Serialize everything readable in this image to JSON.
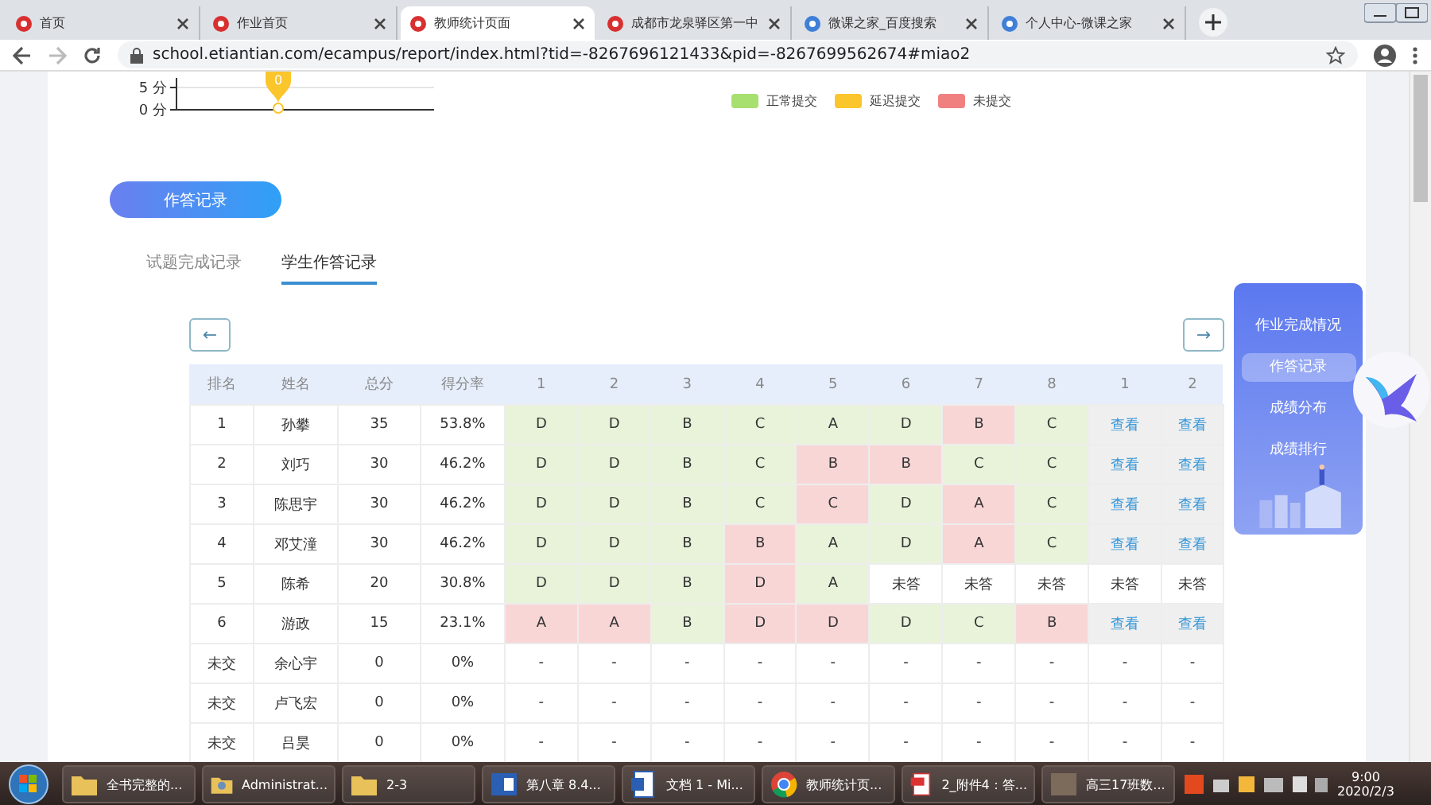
{
  "browser": {
    "tabs": [
      {
        "title": "首页",
        "selected": false
      },
      {
        "title": "作业首页",
        "selected": false
      },
      {
        "title": "教师统计页面",
        "selected": true
      },
      {
        "title": "成都市龙泉驿区第一中",
        "selected": false
      },
      {
        "title": "微课之家_百度搜索",
        "selected": false
      },
      {
        "title": "个人中心-微课之家",
        "selected": false
      }
    ],
    "url": "school.etiantian.com/ecampus/report/index.html?tid=-8267696121433&pid=-8267699562674#miao2"
  },
  "score_chart": {
    "y_ticks": [
      "5 分",
      "0 分"
    ],
    "marker_label": "0"
  },
  "legend": [
    {
      "label": "正常提交",
      "color": "#a8e070"
    },
    {
      "label": "延迟提交",
      "color": "#fbc52c"
    },
    {
      "label": "未提交",
      "color": "#f08080"
    }
  ],
  "section_button": "作答记录",
  "tabs": [
    {
      "label": "试题完成记录",
      "selected": false
    },
    {
      "label": "学生作答记录",
      "selected": true
    }
  ],
  "nav": {
    "prev": "←",
    "next": "→"
  },
  "table": {
    "columns": [
      "排名",
      "姓名",
      "总分",
      "得分率",
      "1",
      "2",
      "3",
      "4",
      "5",
      "6",
      "7",
      "8",
      "1",
      "2"
    ],
    "rows": [
      {
        "cells": [
          {
            "kind": "plain",
            "text": "1"
          },
          {
            "kind": "plain",
            "text": "孙攀"
          },
          {
            "kind": "plain",
            "text": "35"
          },
          {
            "kind": "plain",
            "text": "53.8%"
          },
          {
            "kind": "answer",
            "text": "D",
            "correct": true
          },
          {
            "kind": "answer",
            "text": "D",
            "correct": true
          },
          {
            "kind": "answer",
            "text": "B",
            "correct": true
          },
          {
            "kind": "answer",
            "text": "C",
            "correct": true
          },
          {
            "kind": "answer",
            "text": "A",
            "correct": true
          },
          {
            "kind": "answer",
            "text": "D",
            "correct": true
          },
          {
            "kind": "answer",
            "text": "B",
            "correct": false
          },
          {
            "kind": "answer",
            "text": "C",
            "correct": true
          },
          {
            "kind": "link",
            "text": "查看"
          },
          {
            "kind": "link",
            "text": "查看"
          }
        ]
      },
      {
        "cells": [
          {
            "kind": "plain",
            "text": "2"
          },
          {
            "kind": "plain",
            "text": "刘巧"
          },
          {
            "kind": "plain",
            "text": "30"
          },
          {
            "kind": "plain",
            "text": "46.2%"
          },
          {
            "kind": "answer",
            "text": "D",
            "correct": true
          },
          {
            "kind": "answer",
            "text": "D",
            "correct": true
          },
          {
            "kind": "answer",
            "text": "B",
            "correct": true
          },
          {
            "kind": "answer",
            "text": "C",
            "correct": true
          },
          {
            "kind": "answer",
            "text": "B",
            "correct": false
          },
          {
            "kind": "answer",
            "text": "B",
            "correct": false
          },
          {
            "kind": "answer",
            "text": "C",
            "correct": true
          },
          {
            "kind": "answer",
            "text": "C",
            "correct": true
          },
          {
            "kind": "link",
            "text": "查看"
          },
          {
            "kind": "link",
            "text": "查看"
          }
        ]
      },
      {
        "cells": [
          {
            "kind": "plain",
            "text": "3"
          },
          {
            "kind": "plain",
            "text": "陈思宇"
          },
          {
            "kind": "plain",
            "text": "30"
          },
          {
            "kind": "plain",
            "text": "46.2%"
          },
          {
            "kind": "answer",
            "text": "D",
            "correct": true
          },
          {
            "kind": "answer",
            "text": "D",
            "correct": true
          },
          {
            "kind": "answer",
            "text": "B",
            "correct": true
          },
          {
            "kind": "answer",
            "text": "C",
            "correct": true
          },
          {
            "kind": "answer",
            "text": "C",
            "correct": false
          },
          {
            "kind": "answer",
            "text": "D",
            "correct": true
          },
          {
            "kind": "answer",
            "text": "A",
            "correct": false
          },
          {
            "kind": "answer",
            "text": "C",
            "correct": true
          },
          {
            "kind": "link",
            "text": "查看"
          },
          {
            "kind": "link",
            "text": "查看"
          }
        ]
      },
      {
        "cells": [
          {
            "kind": "plain",
            "text": "4"
          },
          {
            "kind": "plain",
            "text": "邓艾潼"
          },
          {
            "kind": "plain",
            "text": "30"
          },
          {
            "kind": "plain",
            "text": "46.2%"
          },
          {
            "kind": "answer",
            "text": "D",
            "correct": true
          },
          {
            "kind": "answer",
            "text": "D",
            "correct": true
          },
          {
            "kind": "answer",
            "text": "B",
            "correct": true
          },
          {
            "kind": "answer",
            "text": "B",
            "correct": false
          },
          {
            "kind": "answer",
            "text": "A",
            "correct": true
          },
          {
            "kind": "answer",
            "text": "D",
            "correct": true
          },
          {
            "kind": "answer",
            "text": "A",
            "correct": false
          },
          {
            "kind": "answer",
            "text": "C",
            "correct": true
          },
          {
            "kind": "link",
            "text": "查看"
          },
          {
            "kind": "link",
            "text": "查看"
          }
        ]
      },
      {
        "cells": [
          {
            "kind": "plain",
            "text": "5"
          },
          {
            "kind": "plain",
            "text": "陈希"
          },
          {
            "kind": "plain",
            "text": "20"
          },
          {
            "kind": "plain",
            "text": "30.8%"
          },
          {
            "kind": "answer",
            "text": "D",
            "correct": true
          },
          {
            "kind": "answer",
            "text": "D",
            "correct": true
          },
          {
            "kind": "answer",
            "text": "B",
            "correct": true
          },
          {
            "kind": "answer",
            "text": "D",
            "correct": false
          },
          {
            "kind": "answer",
            "text": "A",
            "correct": true
          },
          {
            "kind": "plain",
            "text": "未答"
          },
          {
            "kind": "plain",
            "text": "未答"
          },
          {
            "kind": "plain",
            "text": "未答"
          },
          {
            "kind": "plain",
            "text": "未答"
          },
          {
            "kind": "plain",
            "text": "未答"
          }
        ]
      },
      {
        "cells": [
          {
            "kind": "plain",
            "text": "6"
          },
          {
            "kind": "plain",
            "text": "游政"
          },
          {
            "kind": "plain",
            "text": "15"
          },
          {
            "kind": "plain",
            "text": "23.1%"
          },
          {
            "kind": "answer",
            "text": "A",
            "correct": false
          },
          {
            "kind": "answer",
            "text": "A",
            "correct": false
          },
          {
            "kind": "answer",
            "text": "B",
            "correct": true
          },
          {
            "kind": "answer",
            "text": "D",
            "correct": false
          },
          {
            "kind": "answer",
            "text": "D",
            "correct": false
          },
          {
            "kind": "answer",
            "text": "D",
            "correct": true
          },
          {
            "kind": "answer",
            "text": "C",
            "correct": true
          },
          {
            "kind": "answer",
            "text": "B",
            "correct": false
          },
          {
            "kind": "link",
            "text": "查看"
          },
          {
            "kind": "link",
            "text": "查看"
          }
        ]
      },
      {
        "cells": [
          {
            "kind": "plain",
            "text": "未交"
          },
          {
            "kind": "plain",
            "text": "余心宇"
          },
          {
            "kind": "plain",
            "text": "0"
          },
          {
            "kind": "plain",
            "text": "0%"
          },
          {
            "kind": "plain",
            "text": "-"
          },
          {
            "kind": "plain",
            "text": "-"
          },
          {
            "kind": "plain",
            "text": "-"
          },
          {
            "kind": "plain",
            "text": "-"
          },
          {
            "kind": "plain",
            "text": "-"
          },
          {
            "kind": "plain",
            "text": "-"
          },
          {
            "kind": "plain",
            "text": "-"
          },
          {
            "kind": "plain",
            "text": "-"
          },
          {
            "kind": "plain",
            "text": "-"
          },
          {
            "kind": "plain",
            "text": "-"
          }
        ]
      },
      {
        "cells": [
          {
            "kind": "plain",
            "text": "未交"
          },
          {
            "kind": "plain",
            "text": "卢飞宏"
          },
          {
            "kind": "plain",
            "text": "0"
          },
          {
            "kind": "plain",
            "text": "0%"
          },
          {
            "kind": "plain",
            "text": "-"
          },
          {
            "kind": "plain",
            "text": "-"
          },
          {
            "kind": "plain",
            "text": "-"
          },
          {
            "kind": "plain",
            "text": "-"
          },
          {
            "kind": "plain",
            "text": "-"
          },
          {
            "kind": "plain",
            "text": "-"
          },
          {
            "kind": "plain",
            "text": "-"
          },
          {
            "kind": "plain",
            "text": "-"
          },
          {
            "kind": "plain",
            "text": "-"
          },
          {
            "kind": "plain",
            "text": "-"
          }
        ]
      },
      {
        "cells": [
          {
            "kind": "plain",
            "text": "未交"
          },
          {
            "kind": "plain",
            "text": "吕昊"
          },
          {
            "kind": "plain",
            "text": "0"
          },
          {
            "kind": "plain",
            "text": "0%"
          },
          {
            "kind": "plain",
            "text": "-"
          },
          {
            "kind": "plain",
            "text": "-"
          },
          {
            "kind": "plain",
            "text": "-"
          },
          {
            "kind": "plain",
            "text": "-"
          },
          {
            "kind": "plain",
            "text": "-"
          },
          {
            "kind": "plain",
            "text": "-"
          },
          {
            "kind": "plain",
            "text": "-"
          },
          {
            "kind": "plain",
            "text": "-"
          },
          {
            "kind": "plain",
            "text": "-"
          },
          {
            "kind": "plain",
            "text": "-"
          }
        ]
      }
    ]
  },
  "side_menu": [
    {
      "label": "作业完成情况",
      "selected": false
    },
    {
      "label": "作答记录",
      "selected": true
    },
    {
      "label": "成绩分布",
      "selected": false
    },
    {
      "label": "成绩排行",
      "selected": false
    }
  ],
  "taskbar": {
    "items": [
      {
        "kind": "folder",
        "label": "全书完整的..."
      },
      {
        "kind": "user-folder",
        "label": "Administrat..."
      },
      {
        "kind": "folder",
        "label": "2-3"
      },
      {
        "kind": "word",
        "label": "第八章 8.4..."
      },
      {
        "kind": "doc",
        "label": "文档 1 - Mi..."
      },
      {
        "kind": "browser",
        "label": "教师统计页..."
      },
      {
        "kind": "pdf",
        "label": "2_附件4：答..."
      },
      {
        "kind": "image",
        "label": "高三17班数..."
      }
    ],
    "time": "9:00",
    "date": "2020/2/3"
  }
}
